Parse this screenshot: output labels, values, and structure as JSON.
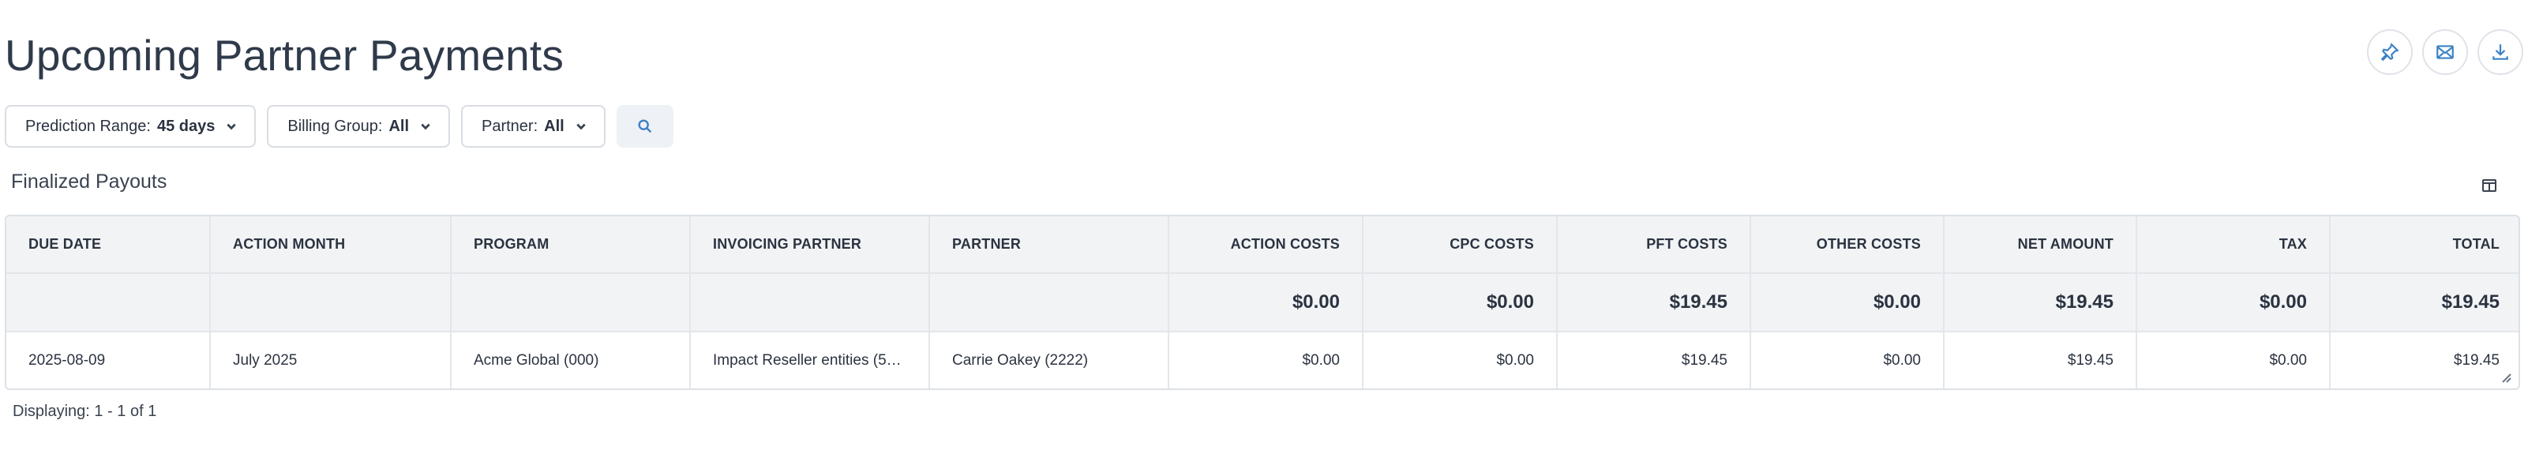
{
  "page": {
    "title": "Upcoming Partner Payments"
  },
  "header_actions": [
    {
      "icon": "pin-icon"
    },
    {
      "icon": "mail-icon"
    },
    {
      "icon": "download-icon"
    }
  ],
  "filters": {
    "prediction_range": {
      "label": "Prediction Range:",
      "value": "45 days"
    },
    "billing_group": {
      "label": "Billing Group:",
      "value": "All"
    },
    "partner": {
      "label": "Partner:",
      "value": "All"
    }
  },
  "section": {
    "title": "Finalized Payouts"
  },
  "table": {
    "columns": [
      "Due Date",
      "Action Month",
      "Program",
      "Invoicing Partner",
      "Partner",
      "Action Costs",
      "CPC Costs",
      "PFT Costs",
      "Other Costs",
      "Net Amount",
      "Tax",
      "Total"
    ],
    "totals": [
      "",
      "",
      "",
      "",
      "",
      "$0.00",
      "$0.00",
      "$19.45",
      "$0.00",
      "$19.45",
      "$0.00",
      "$19.45"
    ],
    "rows": [
      [
        "2025-08-09",
        "July 2025",
        "Acme Global (000)",
        "Impact Reseller entities (57...",
        "Carrie Oakey (2222)",
        "$0.00",
        "$0.00",
        "$19.45",
        "$0.00",
        "$19.45",
        "$0.00",
        "$19.45"
      ]
    ]
  },
  "footer": {
    "displaying": "Displaying: 1 - 1 of 1"
  },
  "colors": {
    "accent": "#3b82c4",
    "link": "#2f6fb8",
    "header_bg": "#f1f3f5",
    "border": "#dde1e6"
  }
}
